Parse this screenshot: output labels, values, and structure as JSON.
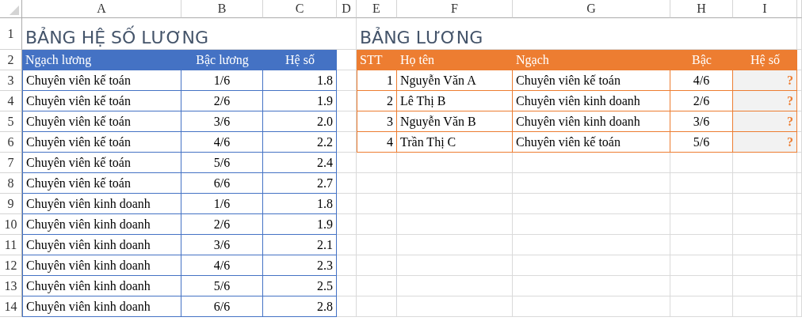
{
  "columns": [
    "A",
    "B",
    "C",
    "D",
    "E",
    "F",
    "G",
    "H",
    "I"
  ],
  "row_numbers": [
    "1",
    "2",
    "3",
    "4",
    "5",
    "6",
    "7",
    "8",
    "9",
    "10",
    "11",
    "12",
    "13",
    "14"
  ],
  "coefficient_table": {
    "title": "BẢNG HỆ SỐ LƯƠNG",
    "header": [
      "Ngạch lương",
      "Bậc lương",
      "Hệ số"
    ],
    "rows": [
      [
        "Chuyên viên kế toán",
        "1/6",
        "1.8"
      ],
      [
        "Chuyên viên kế toán",
        "2/6",
        "1.9"
      ],
      [
        "Chuyên viên kế toán",
        "3/6",
        "2.0"
      ],
      [
        "Chuyên viên kế toán",
        "4/6",
        "2.2"
      ],
      [
        "Chuyên viên kế toán",
        "5/6",
        "2.4"
      ],
      [
        "Chuyên viên kế toán",
        "6/6",
        "2.7"
      ],
      [
        "Chuyên viên kinh doanh",
        "1/6",
        "1.8"
      ],
      [
        "Chuyên viên kinh doanh",
        "2/6",
        "1.9"
      ],
      [
        "Chuyên viên kinh doanh",
        "3/6",
        "2.1"
      ],
      [
        "Chuyên viên kinh doanh",
        "4/6",
        "2.3"
      ],
      [
        "Chuyên viên kinh doanh",
        "5/6",
        "2.5"
      ],
      [
        "Chuyên viên kinh doanh",
        "6/6",
        "2.8"
      ]
    ]
  },
  "salary_table": {
    "title": "BẢNG LƯƠNG",
    "header": [
      "STT",
      "Họ tên",
      "Ngạch",
      "Bậc",
      "Hệ số"
    ],
    "rows": [
      [
        "1",
        "Nguyễn Văn A",
        "Chuyên viên kế toán",
        "4/6",
        "?"
      ],
      [
        "2",
        "Lê Thị B",
        "Chuyên viên kinh doanh",
        "2/6",
        "?"
      ],
      [
        "3",
        "Nguyễn Văn B",
        "Chuyên viên kinh doanh",
        "3/6",
        "?"
      ],
      [
        "4",
        "Trần Thị C",
        "Chuyên viên kế toán",
        "5/6",
        "?"
      ]
    ]
  }
}
